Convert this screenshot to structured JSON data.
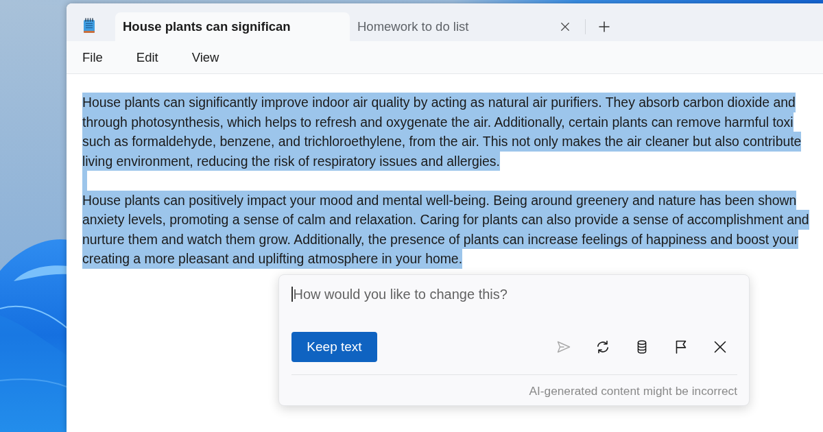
{
  "window": {
    "tabs": [
      {
        "label": "House plants can significan",
        "selected": true,
        "close_button": false
      },
      {
        "label": "Homework to do list",
        "selected": false,
        "close_button": true
      }
    ],
    "menu": [
      "File",
      "Edit",
      "View"
    ],
    "document": {
      "paragraphs": [
        {
          "selected": true,
          "lines": [
            "House plants can significantly improve indoor air quality by acting as natural air purifiers. They absorb carbon dioxide and",
            "through photosynthesis, which helps to refresh and oxygenate the air. Additionally, certain plants can remove harmful toxi",
            "such as formaldehyde, benzene, and trichloroethylene, from the air. This not only makes the air cleaner but also contribute",
            "living environment, reducing the risk of respiratory issues and allergies."
          ]
        },
        {
          "selected": true,
          "lines": [
            "House plants can positively impact your mood and mental well-being. Being around greenery and nature has been shown",
            "anxiety levels, promoting a sense of calm and relaxation. Caring for plants can also provide a sense of accomplishment and",
            "nurture them and watch them grow. Additionally, the presence of plants can increase feelings of happiness and boost your",
            "creating a more pleasant and uplifting atmosphere in your home."
          ]
        }
      ]
    }
  },
  "rewrite_panel": {
    "placeholder": "How would you like to change this?",
    "primary_button": "Keep text",
    "actions": [
      {
        "kind": "send",
        "disabled": true
      },
      {
        "kind": "regenerate",
        "disabled": false
      },
      {
        "kind": "stack",
        "disabled": false
      },
      {
        "kind": "flag",
        "disabled": false
      },
      {
        "kind": "close",
        "disabled": false
      }
    ],
    "disclaimer": "AI-generated content might be incorrect"
  }
}
